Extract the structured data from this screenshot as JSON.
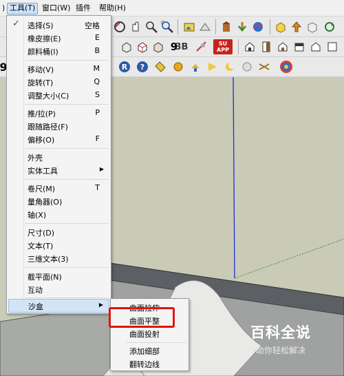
{
  "menubar": {
    "items": [
      {
        "label": ")"
      },
      {
        "label": "工具(T)"
      },
      {
        "label": "窗口(W)"
      },
      {
        "label": "插件"
      },
      {
        "label": "帮助(H)"
      }
    ]
  },
  "toolbar": {
    "row3_glyphs": [
      "9"
    ],
    "row2_glyphs": [
      "3B",
      "SU APP"
    ]
  },
  "tools_menu": {
    "items": [
      {
        "label": "选择(S)",
        "key": "空格",
        "checked": true
      },
      {
        "label": "橡皮擦(E)",
        "key": "E"
      },
      {
        "label": "颜料桶(I)",
        "key": "B"
      },
      {
        "label": "移动(V)",
        "key": "M"
      },
      {
        "label": "旋转(T)",
        "key": "Q"
      },
      {
        "label": "调整大小(C)",
        "key": "S"
      },
      {
        "label": "推/拉(P)",
        "key": "P"
      },
      {
        "label": "跟随路径(F)",
        "key": ""
      },
      {
        "label": "偏移(O)",
        "key": "F"
      },
      {
        "label": "外壳",
        "key": ""
      },
      {
        "label": "实体工具",
        "key": "",
        "submenu": true
      },
      {
        "label": "卷尺(M)",
        "key": "T"
      },
      {
        "label": "量角器(O)",
        "key": ""
      },
      {
        "label": "轴(X)",
        "key": ""
      },
      {
        "label": "尺寸(D)",
        "key": ""
      },
      {
        "label": "文本(T)",
        "key": ""
      },
      {
        "label": "三维文本(3)",
        "key": ""
      },
      {
        "label": "截平面(N)",
        "key": ""
      },
      {
        "label": "互动",
        "key": ""
      },
      {
        "label": "沙盒",
        "key": "",
        "submenu": true,
        "hover": true
      }
    ]
  },
  "sandbox_menu": {
    "items": [
      {
        "label": "曲面拉伸"
      },
      {
        "label": "曲面平整",
        "highlighted": true
      },
      {
        "label": "曲面投射"
      },
      {
        "label": "添加细部"
      },
      {
        "label": "翻转边线"
      }
    ]
  },
  "watermark": {
    "title": "百科全说",
    "subtitle": "助你轻松解决"
  },
  "colors": {
    "accent_highlight": "#e0140c",
    "menu_hover": "#d3e4f7",
    "viewport_bg": "#c9cbb6",
    "axis_blue": "#1f2bd6"
  }
}
